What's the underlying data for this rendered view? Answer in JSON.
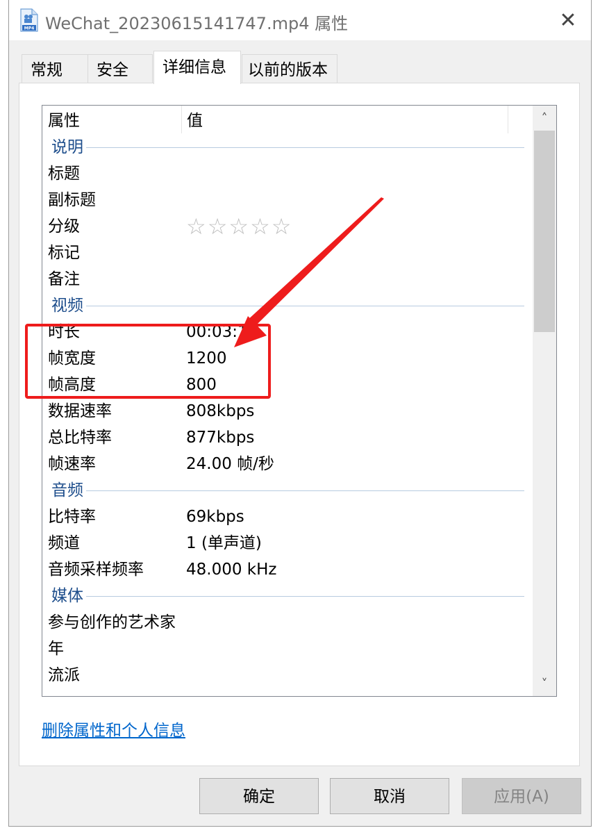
{
  "window": {
    "title": "WeChat_20230615141747.mp4 属性",
    "icon_label": "MP4",
    "close_glyph": "✕"
  },
  "tabs": [
    {
      "label": "常规",
      "active": false
    },
    {
      "label": "安全",
      "active": false
    },
    {
      "label": "详细信息",
      "active": true
    },
    {
      "label": "以前的版本",
      "active": false
    }
  ],
  "list": {
    "columns": {
      "property": "属性",
      "value": "值"
    },
    "groups": [
      {
        "name": "说明",
        "rows": [
          {
            "name": "标题",
            "value": ""
          },
          {
            "name": "副标题",
            "value": ""
          },
          {
            "name": "分级",
            "value": "",
            "rating_stars": 5,
            "rating_filled": 0
          },
          {
            "name": "标记",
            "value": ""
          },
          {
            "name": "备注",
            "value": ""
          }
        ]
      },
      {
        "name": "视频",
        "rows": [
          {
            "name": "时长",
            "value": "00:03:1"
          },
          {
            "name": "帧宽度",
            "value": "1200"
          },
          {
            "name": "帧高度",
            "value": "800"
          },
          {
            "name": "数据速率",
            "value": "808kbps"
          },
          {
            "name": "总比特率",
            "value": "877kbps"
          },
          {
            "name": "帧速率",
            "value": "24.00 帧/秒"
          }
        ]
      },
      {
        "name": "音频",
        "rows": [
          {
            "name": "比特率",
            "value": "69kbps"
          },
          {
            "name": "频道",
            "value": "1 (单声道)"
          },
          {
            "name": "音频采样频率",
            "value": "48.000 kHz"
          }
        ]
      },
      {
        "name": "媒体",
        "rows": [
          {
            "name": "参与创作的艺术家",
            "value": ""
          },
          {
            "name": "年",
            "value": ""
          },
          {
            "name": "流派",
            "value": ""
          }
        ]
      }
    ]
  },
  "scrollbar": {
    "up_glyph": "˄",
    "down_glyph": "˅"
  },
  "link": {
    "label": "删除属性和个人信息"
  },
  "buttons": {
    "ok": "确定",
    "cancel": "取消",
    "apply": "应用(A)",
    "apply_enabled": false
  },
  "annotation": {
    "color": "#ee1c1c"
  },
  "colors": {
    "group_header": "#1e4e8c",
    "link": "#0066cc",
    "star_empty": "#bdbdbd"
  }
}
